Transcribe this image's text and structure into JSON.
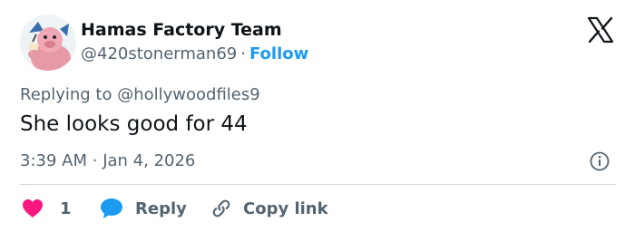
{
  "author": {
    "name": "Hamas Factory Team",
    "handle": "@420stonerman69",
    "separator": "·",
    "follow_label": "Follow"
  },
  "reply_context": {
    "prefix": "Replying to",
    "handle": "@hollywoodfiles9"
  },
  "tweet": {
    "text": "She looks good for 44",
    "time": "3:39 AM",
    "separator": "·",
    "date": "Jan 4, 2026"
  },
  "actions": {
    "like_count": "1",
    "reply_label": "Reply",
    "copy_link_label": "Copy link"
  },
  "icons": {
    "brand": "x-logo-icon",
    "info": "info-icon",
    "like": "heart-icon",
    "reply": "speech-bubble-icon",
    "copy_link": "link-icon"
  },
  "colors": {
    "accent": "#1d9bf0",
    "like": "#f91880",
    "text": "#0f1419",
    "secondary": "#536471",
    "divider": "#cfd9de"
  }
}
